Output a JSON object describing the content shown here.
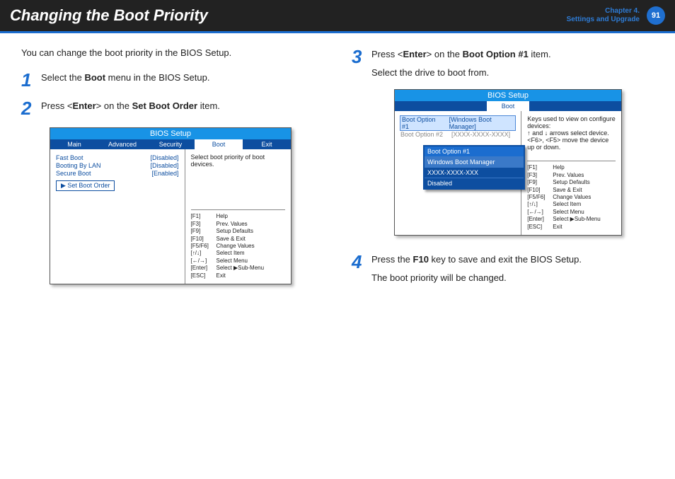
{
  "header": {
    "title": "Changing the Boot Priority",
    "chapter_line1": "Chapter 4.",
    "chapter_line2": "Settings and Upgrade",
    "page_number": "91"
  },
  "intro": "You can change the boot priority in the BIOS Setup.",
  "steps": {
    "s1": {
      "n": "1",
      "pre": "Select the ",
      "b1": "Boot",
      "post": " menu in the BIOS Setup."
    },
    "s2": {
      "n": "2",
      "pre": "Press <",
      "b1": "Enter",
      "mid": "> on the ",
      "b2": "Set Boot Order",
      "post": " item."
    },
    "s3": {
      "n": "3",
      "pre": "Press <",
      "b1": "Enter",
      "mid": "> on the ",
      "b2": "Boot Option #1",
      "post": " item.",
      "line2": "Select the drive to boot from."
    },
    "s4": {
      "n": "4",
      "pre": "Press the ",
      "b1": "F10",
      "post": " key to save and exit the BIOS Setup.",
      "line2": "The boot priority will be changed."
    }
  },
  "bios1": {
    "title": "BIOS Setup",
    "tabs": {
      "main": "Main",
      "advanced": "Advanced",
      "security": "Security",
      "boot": "Boot",
      "exit": "Exit"
    },
    "settings": {
      "fastboot": {
        "k": "Fast Boot",
        "v": "[Disabled]"
      },
      "lan": {
        "k": "Booting By LAN",
        "v": "[Disabled]"
      },
      "secure": {
        "k": "Secure Boot",
        "v": "[Enabled]"
      }
    },
    "setbootorder": "▶ Set Boot Order",
    "desc": "Select boot priority of boot devices.",
    "keys": {
      "f1": {
        "k": "[F1]",
        "v": "Help"
      },
      "f3": {
        "k": "[F3]",
        "v": "Prev. Values"
      },
      "f9": {
        "k": "[F9]",
        "v": "Setup Defaults"
      },
      "f10": {
        "k": "[F10]",
        "v": "Save & Exit"
      },
      "f5f6": {
        "k": "[F5/F6]",
        "v": "Change Values"
      },
      "ud": {
        "k": "[↑/↓]",
        "v": "Select Item"
      },
      "lr": {
        "k": "[←/→]",
        "v": "Select Menu"
      },
      "enter": {
        "k": "[Enter]",
        "v": "Select ▶Sub-Menu"
      },
      "esc": {
        "k": "[ESC]",
        "v": "Exit"
      }
    }
  },
  "bios2": {
    "title": "BIOS Setup",
    "tab": "Boot",
    "options": {
      "o1": {
        "k": "Boot Option  #1",
        "v": "[Windows Boot Manager]"
      },
      "o2": {
        "k": "Boot Option  #2",
        "v": "[XXXX-XXXX-XXXX]"
      }
    },
    "desc": "Keys used to view on configure devices:\n↑  and ↓  arrows select device.\n<F6>, <F5> move the device up or down.",
    "popup": {
      "title": "Boot Option  #1",
      "i1": "Windows Boot Manager",
      "i2": "XXXX-XXXX-XXX",
      "i3": "Disabled"
    },
    "keys": {
      "f1": {
        "k": "[F1]",
        "v": "Help"
      },
      "f3": {
        "k": "[F3]",
        "v": "Prev. Values"
      },
      "f9": {
        "k": "[F9]",
        "v": "Setup Defaults"
      },
      "f10": {
        "k": "[F10]",
        "v": "Save & Exit"
      },
      "f5f6": {
        "k": "[F5/F6]",
        "v": "Change Values"
      },
      "ud": {
        "k": "[↑/↓]",
        "v": "Select Item"
      },
      "lr": {
        "k": "[←/→]",
        "v": "Select Menu"
      },
      "enter": {
        "k": "[Enter]",
        "v": "Select ▶Sub-Menu"
      },
      "esc": {
        "k": "[ESC]",
        "v": "Exit"
      }
    }
  }
}
